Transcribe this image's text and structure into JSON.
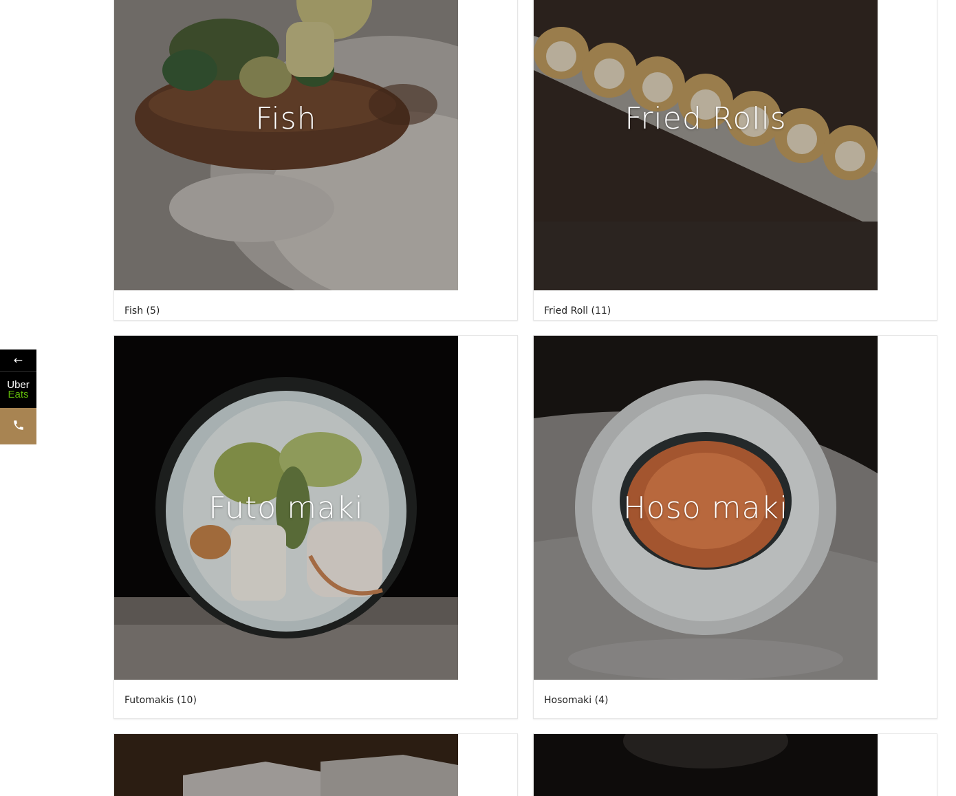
{
  "side_widget": {
    "back_glyph": "←",
    "uber_line1": "Uber",
    "uber_line2": "Eats",
    "phone_icon": "phone-icon",
    "colors": {
      "dark": "#000000",
      "uber_green": "#5fb709",
      "phone_bg": "#a88452"
    }
  },
  "categories": [
    {
      "title": "Fish",
      "caption": "Fish (5)"
    },
    {
      "title": "Fried Rolls",
      "caption": "Fried Roll (11)"
    },
    {
      "title": "Futo maki",
      "caption": "Futomakis (10)"
    },
    {
      "title": "Hoso maki",
      "caption": "Hosomaki (4)"
    },
    {
      "title": "",
      "caption": ""
    },
    {
      "title": "",
      "caption": ""
    }
  ]
}
